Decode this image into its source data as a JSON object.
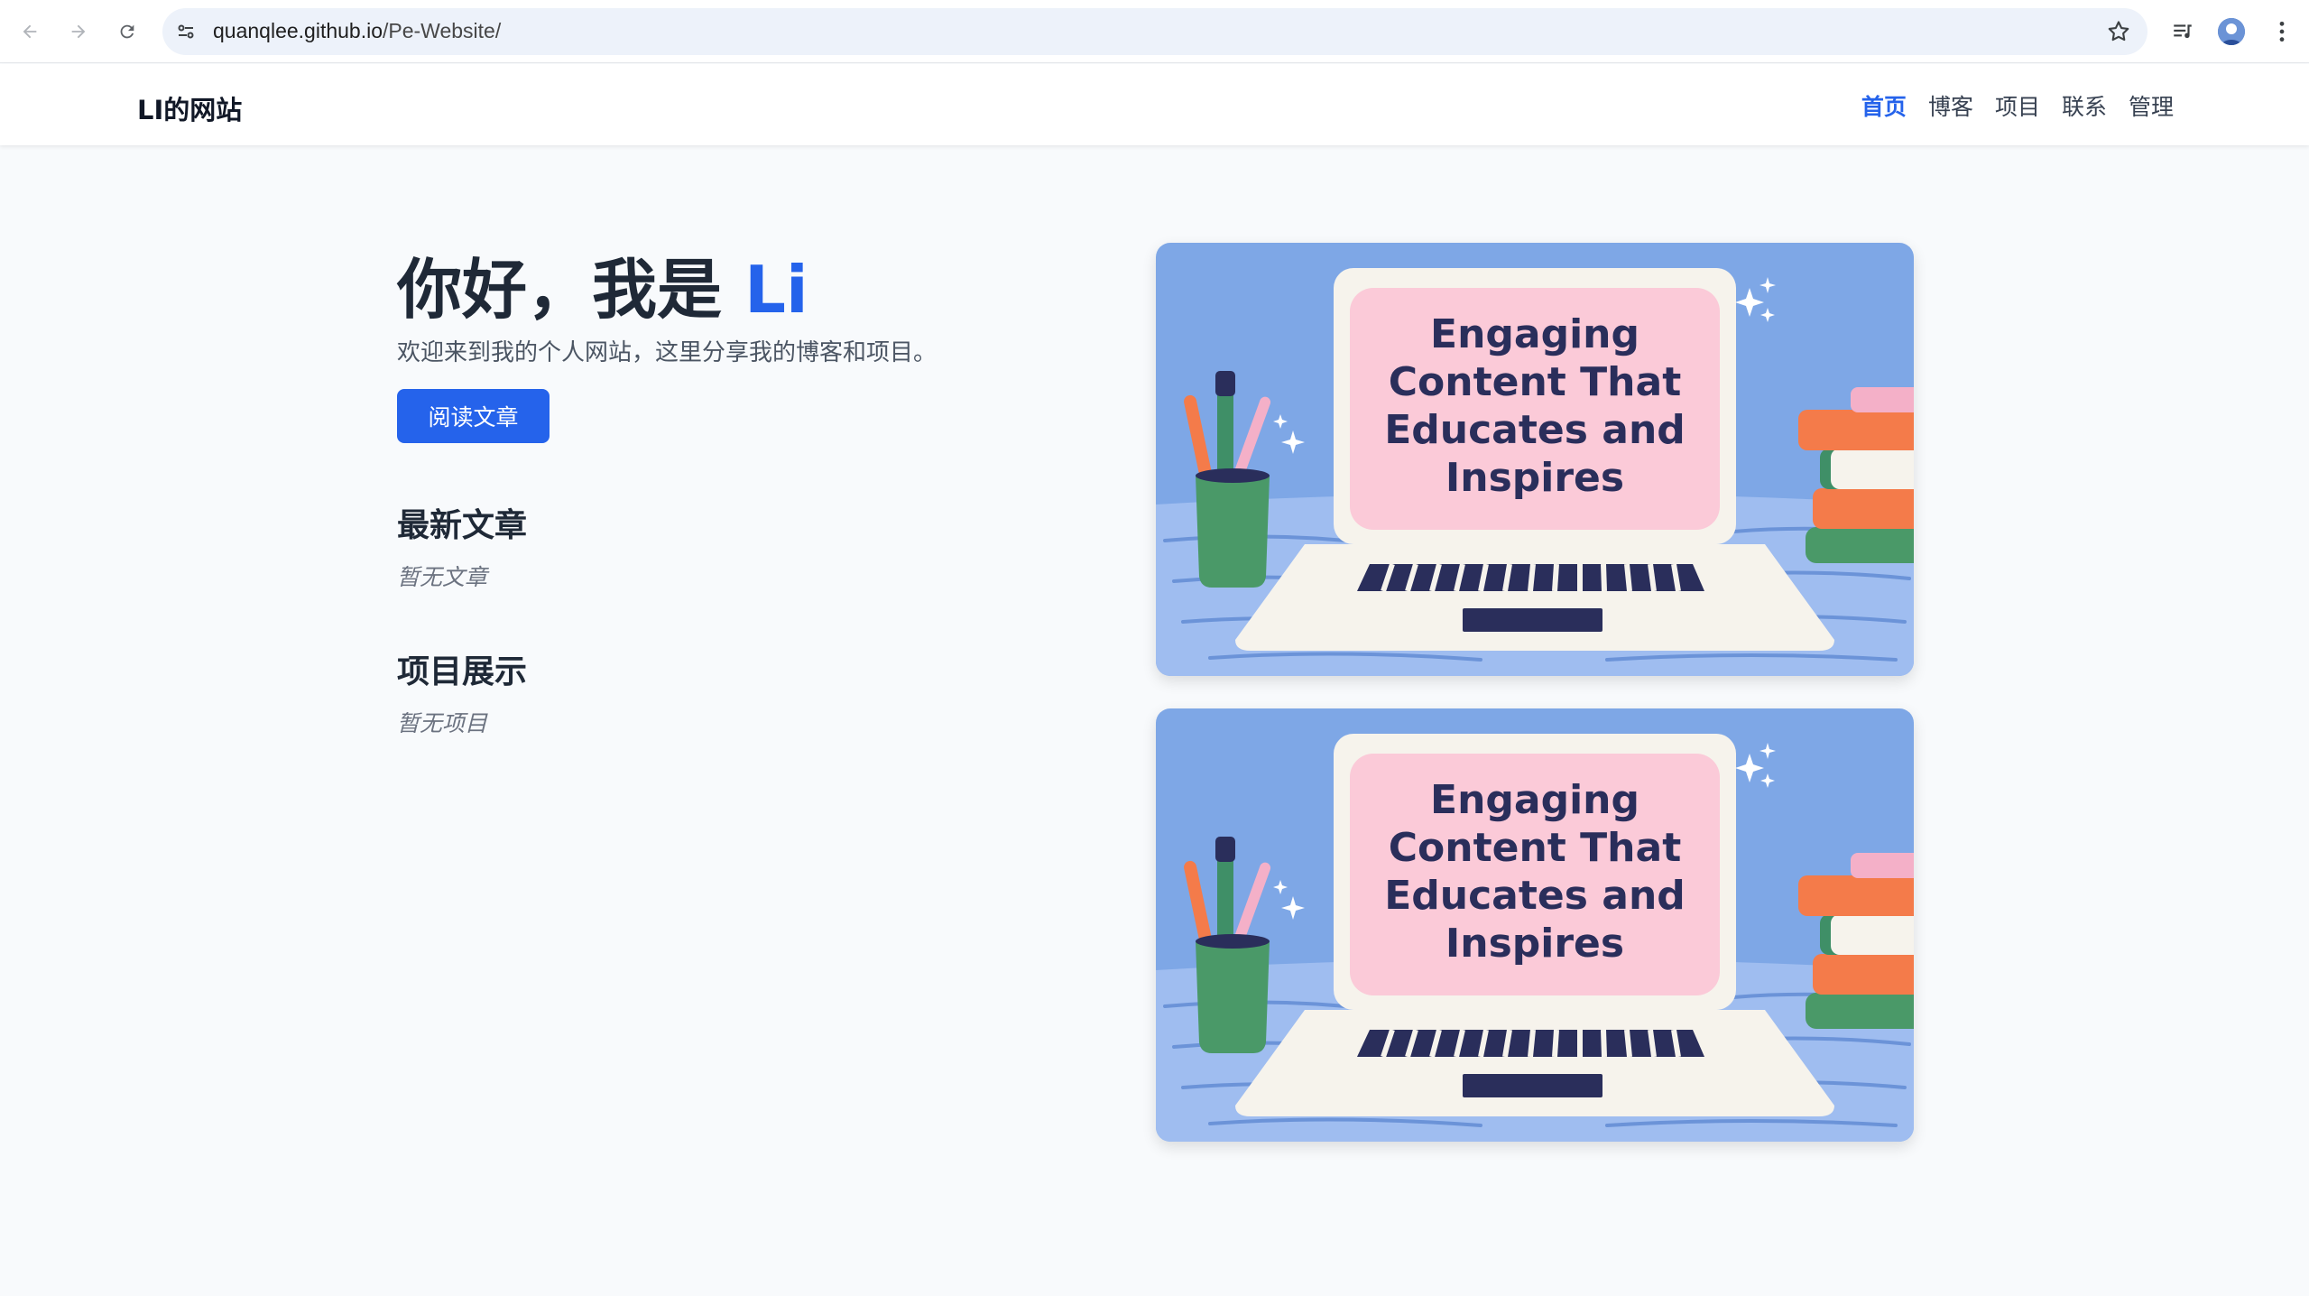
{
  "browser": {
    "url_host": "quanqlee.github.io",
    "url_path": "/Pe-Website/"
  },
  "site": {
    "logo": "LI的网站",
    "nav": [
      {
        "label": "首页",
        "active": true
      },
      {
        "label": "博客",
        "active": false
      },
      {
        "label": "项目",
        "active": false
      },
      {
        "label": "联系",
        "active": false
      },
      {
        "label": "管理",
        "active": false
      }
    ]
  },
  "hero": {
    "greeting": "你好，我是 ",
    "name": "Li",
    "subtitle": "欢迎来到我的个人网站，这里分享我的博客和项目。",
    "button": "阅读文章"
  },
  "sections": {
    "latest_title": "最新文章",
    "latest_empty": "暂无文章",
    "projects_title": "项目展示",
    "projects_empty": "暂无项目"
  },
  "cards": [
    {
      "lines": [
        "Engaging",
        "Content That",
        "Educates and",
        "Inspires"
      ]
    },
    {
      "lines": [
        "Engaging",
        "Content That",
        "Educates and",
        "Inspires"
      ]
    }
  ],
  "colors": {
    "accent": "#2563eb",
    "card_bg": "#7ea7e6",
    "screen_pink": "#fbcad8"
  }
}
